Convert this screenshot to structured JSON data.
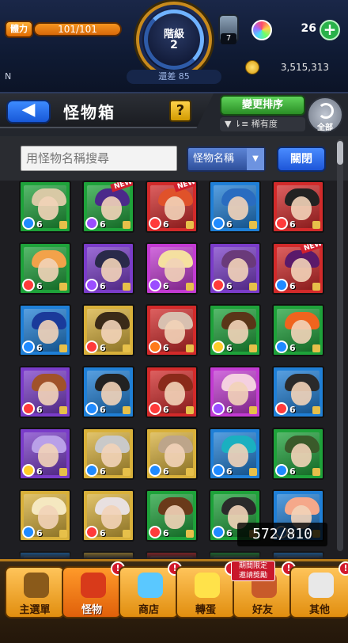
{
  "status": {
    "stamina_label": "體力",
    "stamina_value": "101/101",
    "rank_label": "階級",
    "rank_value": "2",
    "rank_diff": "還差 85",
    "lantern_count": "7",
    "orb_count": "26",
    "orb_plus": "+",
    "gold_count": "3,515,313",
    "corner_text": "N"
  },
  "titlebar": {
    "back_label": "◀",
    "title": "怪物箱",
    "help_label": "?",
    "sort_label": "變更排序",
    "sort_current": "▼ ⇂≡ 稀有度",
    "all_label": "全部"
  },
  "search": {
    "placeholder": "用怪物名稱搜尋",
    "filter_value": "怪物名稱",
    "filter_caret": "▼",
    "close_label": "關閉"
  },
  "box": {
    "count": "572/810"
  },
  "monsters": [
    {
      "elem": "#1f8aff",
      "bg": "#1ea23a",
      "hair": "#d8c9a5",
      "lvl": "6",
      "new": ""
    },
    {
      "elem": "#9b4dff",
      "bg": "#1ea23a",
      "hair": "#4b2a8a",
      "lvl": "6",
      "new": "NEW"
    },
    {
      "elem": "#ff3b3b",
      "bg": "#d22a2a",
      "hair": "#e0522a",
      "lvl": "6",
      "new": "NEW"
    },
    {
      "elem": "#1f8aff",
      "bg": "#1f7fd6",
      "hair": "#2a6cc0",
      "lvl": "6",
      "new": ""
    },
    {
      "elem": "#ff3b3b",
      "bg": "#d22a2a",
      "hair": "#222",
      "lvl": "6",
      "new": ""
    },
    {
      "elem": "#ff3b3b",
      "bg": "#1ea23a",
      "hair": "#f2a24a",
      "lvl": "6",
      "new": ""
    },
    {
      "elem": "#9b4dff",
      "bg": "#7a3cc9",
      "hair": "#2a2a4a",
      "lvl": "6",
      "new": ""
    },
    {
      "elem": "#9b4dff",
      "bg": "#c23ad2",
      "hair": "#f5e0a0",
      "lvl": "6",
      "new": ""
    },
    {
      "elem": "#ff3b3b",
      "bg": "#7a3cc9",
      "hair": "#6a3a7a",
      "lvl": "6",
      "new": ""
    },
    {
      "elem": "#1f8aff",
      "bg": "#d22a2a",
      "hair": "#5a1a6a",
      "lvl": "6",
      "new": "NEW"
    },
    {
      "elem": "#1f8aff",
      "bg": "#1f7fd6",
      "hair": "#1a3a9a",
      "lvl": "6",
      "new": ""
    },
    {
      "elem": "#ff3b3b",
      "bg": "#d8b03a",
      "hair": "#3a2a18",
      "lvl": "6",
      "new": ""
    },
    {
      "elem": "#ff7a1a",
      "bg": "#d22a2a",
      "hair": "#d8c0b0",
      "lvl": "6",
      "new": ""
    },
    {
      "elem": "#ffcc2a",
      "bg": "#1ea23a",
      "hair": "#5a3518",
      "lvl": "6",
      "new": ""
    },
    {
      "elem": "#1f8aff",
      "bg": "#1ea23a",
      "hair": "#f0641e",
      "lvl": "6",
      "new": ""
    },
    {
      "elem": "#ff3b3b",
      "bg": "#7a3cc9",
      "hair": "#a0522a",
      "lvl": "6",
      "new": ""
    },
    {
      "elem": "#1f8aff",
      "bg": "#1f7fd6",
      "hair": "#222",
      "lvl": "6",
      "new": ""
    },
    {
      "elem": "#ff3b3b",
      "bg": "#d22a2a",
      "hair": "#8a2a1a",
      "lvl": "6",
      "new": ""
    },
    {
      "elem": "#9b4dff",
      "bg": "#c23ad2",
      "hair": "#f4d0e0",
      "lvl": "6",
      "new": ""
    },
    {
      "elem": "#ff3b3b",
      "bg": "#1f7fd6",
      "hair": "#2a2a2a",
      "lvl": "6",
      "new": ""
    },
    {
      "elem": "#ffcc2a",
      "bg": "#7a3cc9",
      "hair": "#b9a0e8",
      "lvl": "6",
      "new": ""
    },
    {
      "elem": "#1f8aff",
      "bg": "#d8b03a",
      "hair": "#c9c9c9",
      "lvl": "6",
      "new": ""
    },
    {
      "elem": "#1f8aff",
      "bg": "#d8b03a",
      "hair": "#bda58a",
      "lvl": "6",
      "new": ""
    },
    {
      "elem": "#1f8aff",
      "bg": "#1f7fd6",
      "hair": "#1ab0c0",
      "lvl": "6",
      "new": ""
    },
    {
      "elem": "#1f8aff",
      "bg": "#1ea23a",
      "hair": "#3a5a2a",
      "lvl": "6",
      "new": ""
    },
    {
      "elem": "#1f8aff",
      "bg": "#d8b03a",
      "hair": "#f5e8c0",
      "lvl": "6",
      "new": ""
    },
    {
      "elem": "#ff3b3b",
      "bg": "#d8b03a",
      "hair": "#e8e0e0",
      "lvl": "6",
      "new": ""
    },
    {
      "elem": "#ff3b3b",
      "bg": "#1ea23a",
      "hair": "#6a3a1a",
      "lvl": "6",
      "new": ""
    },
    {
      "elem": "#1f8aff",
      "bg": "#1ea23a",
      "hair": "#2a2a2a",
      "lvl": "6",
      "new": ""
    },
    {
      "elem": "#1f8aff",
      "bg": "#1f7fd6",
      "hair": "#f5a88a",
      "lvl": "6",
      "new": ""
    },
    {
      "elem": "#1f8aff",
      "bg": "#1f7fd6",
      "hair": "#c08a5a",
      "lvl": "",
      "new": ""
    },
    {
      "elem": "#ff3b3b",
      "bg": "#d8b03a",
      "hair": "#d8b03a",
      "lvl": "",
      "new": ""
    },
    {
      "elem": "#ff3b3b",
      "bg": "#d22a2a",
      "hair": "#6a2a2a",
      "lvl": "",
      "new": ""
    },
    {
      "elem": "#1f8aff",
      "bg": "#1ea23a",
      "hair": "#2a2a2a",
      "lvl": "",
      "new": ""
    },
    {
      "elem": "#1f8aff",
      "bg": "#1f7fd6",
      "hair": "#5a3a8a",
      "lvl": "",
      "new": ""
    }
  ],
  "nav": {
    "items": [
      {
        "label": "主選單",
        "icon": "home-icon",
        "color": "#8a5a1a",
        "alert": ""
      },
      {
        "label": "怪物",
        "icon": "monster-icon",
        "color": "#d83a1a",
        "alert": "!"
      },
      {
        "label": "商店",
        "icon": "orb-shop-icon",
        "color": "#5ac8ff",
        "alert": "!"
      },
      {
        "label": "轉蛋",
        "icon": "gacha-egg-icon",
        "color": "#ffe24a",
        "alert": "!"
      },
      {
        "label": "好友",
        "icon": "friends-icon",
        "color": "#c85a2a",
        "alert": "!"
      },
      {
        "label": "其他",
        "icon": "other-icon",
        "color": "#e8e8e8",
        "alert": "!"
      }
    ],
    "event_tag": "期間限定\n邀請獎勵"
  }
}
